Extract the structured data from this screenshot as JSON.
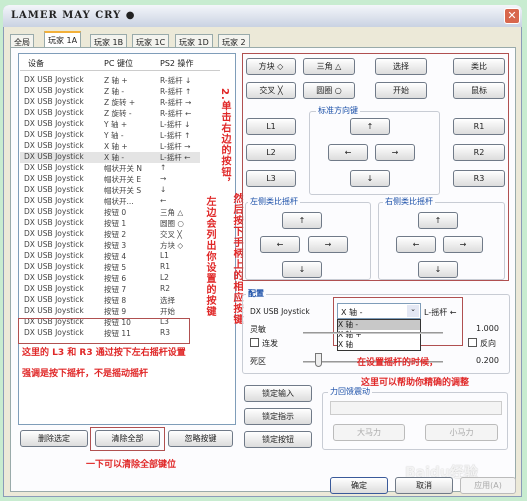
{
  "window": {
    "title": "LAMER MAY CRY ●",
    "close": "✕"
  },
  "tabs": [
    "全局",
    "玩家 1A",
    "玩家 1B",
    "玩家 1C",
    "玩家 1D",
    "玩家 2"
  ],
  "list": {
    "headers": [
      "设备",
      "PC 键位",
      "PS2 操作"
    ],
    "rows": [
      [
        "DX USB Joystick",
        "Z 轴 +",
        "R-摇杆 ↓"
      ],
      [
        "DX USB Joystick",
        "Z 轴 -",
        "R-摇杆 ↑"
      ],
      [
        "DX USB Joystick",
        "Z 旋转 +",
        "R-摇杆 →"
      ],
      [
        "DX USB Joystick",
        "Z 旋转 -",
        "R-摇杆 ←"
      ],
      [
        "DX USB Joystick",
        "Y 轴 +",
        "L-摇杆 ↓"
      ],
      [
        "DX USB Joystick",
        "Y 轴 -",
        "L-摇杆 ↑"
      ],
      [
        "DX USB Joystick",
        "X 轴 +",
        "L-摇杆 →"
      ],
      [
        "DX USB Joystick",
        "X 轴 -",
        "L-摇杆 ←"
      ],
      [
        "DX USB Joystick",
        "帽状开关 N",
        "↑"
      ],
      [
        "DX USB Joystick",
        "帽状开关 E",
        "→"
      ],
      [
        "DX USB Joystick",
        "帽状开关 S",
        "↓"
      ],
      [
        "DX USB Joystick",
        "帽状开...",
        "←"
      ],
      [
        "DX USB Joystick",
        "按钮 0",
        "三角 △"
      ],
      [
        "DX USB Joystick",
        "按钮 1",
        "圆圈 ○"
      ],
      [
        "DX USB Joystick",
        "按钮 2",
        "交叉 ╳"
      ],
      [
        "DX USB Joystick",
        "按钮 3",
        "方块 ◇"
      ],
      [
        "DX USB Joystick",
        "按钮 4",
        "L1"
      ],
      [
        "DX USB Joystick",
        "按钮 5",
        "R1"
      ],
      [
        "DX USB Joystick",
        "按钮 6",
        "L2"
      ],
      [
        "DX USB Joystick",
        "按钮 7",
        "R2"
      ],
      [
        "DX USB Joystick",
        "按钮 8",
        "选择"
      ],
      [
        "DX USB Joystick",
        "按钮 9",
        "开始"
      ],
      [
        "DX USB Joystick",
        "按钮 10",
        "L3"
      ],
      [
        "DX USB Joystick",
        "按钮 11",
        "R3"
      ]
    ],
    "selected_row": 7
  },
  "annotations": {
    "click_right": "2.单击右边的按钮，",
    "press_pad": "然后按下手柄上的相应按键",
    "left_list": "左边会列出你设置的按键",
    "l3r3_1": "这里的 L3 和 R3 通过按下左右摇杆设置",
    "l3r3_2": "强调是按下摇杆，不是摇动摇杆",
    "clear_all": "一下可以清除全部键位",
    "stick_1": "在设置摇杆的时候，",
    "stick_2": "这里可以帮助你精确的调整"
  },
  "list_buttons": {
    "delete": "删除选定",
    "clear": "清除全部",
    "ignore": "忽略按键"
  },
  "buttons": {
    "square": "方块 ◇",
    "triangle": "三角 △",
    "select": "选择",
    "analog": "类比",
    "cross": "交叉 ╳",
    "circle": "圆圈 ○",
    "start": "开始",
    "mouse": "鼠标",
    "l1": "L1",
    "l2": "L2",
    "l3": "L3",
    "r1": "R1",
    "r2": "R2",
    "r3": "R3",
    "up": "↑",
    "down": "↓",
    "left": "←",
    "right": "→"
  },
  "groups": {
    "dpad": "标准方向键",
    "left_stick": "左侧类比摇杆",
    "right_stick": "右侧类比摇杆",
    "config": "配置",
    "force": "力回馈震动"
  },
  "config": {
    "device": "DX USB Joystick",
    "axis_value": "X 轴 -",
    "axis_options": [
      "X 轴 -",
      "X 轴 +",
      "X 轴"
    ],
    "mapping": "L-摇杆 ←",
    "sensitivity_label": "灵敏",
    "sensitivity_value": "1.000",
    "turbo_label": "连发",
    "turbo_checked": false,
    "reverse_label": "反向",
    "reverse_checked": false,
    "deadzone_label": "死区",
    "deadzone_value": "0.200"
  },
  "lock": {
    "input": "锁定输入",
    "indicator": "锁定指示",
    "button": "锁定按钮"
  },
  "force": {
    "big": "大马力",
    "small": "小马力"
  },
  "footer": {
    "ok": "确定",
    "cancel": "取消",
    "apply": "应用(A)"
  },
  "watermark": "Baidu经验"
}
